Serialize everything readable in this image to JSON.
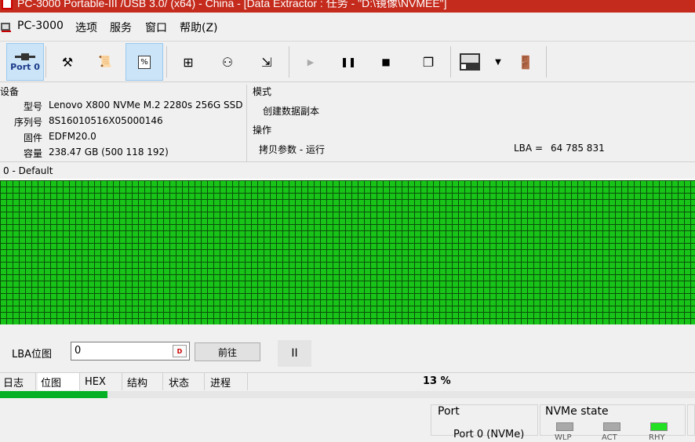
{
  "titlebar": {
    "title": "PC-3000 Portable-III /USB 3.0/ (x64) - China - [Data Extractor : 任务 - \"D:\\镜像\\NVMEE\"]"
  },
  "menu": {
    "app": "PC-3000",
    "items": [
      "选项",
      "服务",
      "窗口",
      "帮助(Z)"
    ]
  },
  "toolbar": {
    "port_label": "Port 0"
  },
  "device": {
    "section": "设备",
    "model_label": "型号",
    "model": "Lenovo X800 NVMe M.2 2280s 256G SSD",
    "serial_label": "序列号",
    "serial": "8S16010516X05000146",
    "firmware_label": "固件",
    "firmware": "EDFM20.0",
    "capacity_label": "容量",
    "capacity": "238.47 GB (500 118 192)"
  },
  "mode": {
    "section": "模式",
    "value": "创建数据副本"
  },
  "operation": {
    "section": "操作",
    "value": "拷贝参数 - 运行",
    "lba_label": "LBA =",
    "lba_value": "64 785 831"
  },
  "map": {
    "title": "0 - Default",
    "status_color": "#19c419"
  },
  "lba_nav": {
    "label": "LBA位图",
    "value": "0",
    "go_label": "前往",
    "pause_glyph": "II"
  },
  "tabs": [
    "日志",
    "位图",
    "HEX",
    "结构",
    "状态",
    "进程"
  ],
  "selected_tab": "位图",
  "progress": {
    "percent_text": "13 %",
    "fraction": 0.155
  },
  "port_group": {
    "title": "Port",
    "value": "Port 0 (NVMe)"
  },
  "nvme_state": {
    "title": "NVMe state",
    "leds": [
      {
        "label": "WLP",
        "on": false
      },
      {
        "label": "ACT",
        "on": false
      },
      {
        "label": "RHY",
        "on": true
      }
    ]
  },
  "colors": {
    "accent": "#cce4f7",
    "progress": "#06b025",
    "map_good": "#19c419"
  }
}
